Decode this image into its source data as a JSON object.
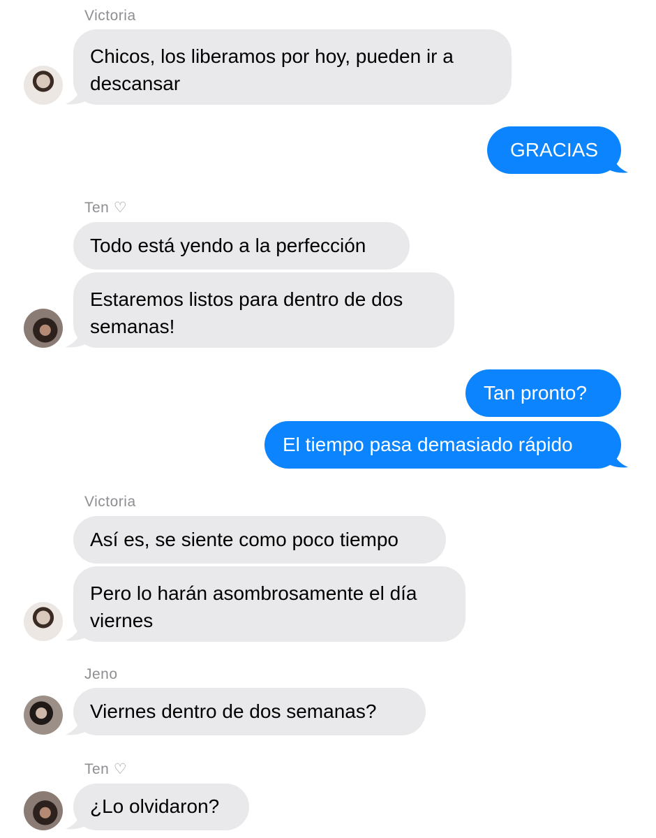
{
  "colors": {
    "incoming_bubble": "#e9e9eb",
    "outgoing_bubble": "#0b84fe",
    "sender_name": "#8e8e93"
  },
  "messages": [
    {
      "sender": "Victoria",
      "text": "Chicos, los liberamos por hoy, pueden ir a descansar"
    },
    {
      "sender": "me",
      "text": "GRACIAS"
    },
    {
      "sender": "Ten ♡",
      "text": "Todo está yendo a la perfección"
    },
    {
      "sender": "Ten ♡",
      "text": "Estaremos listos para dentro de dos semanas!"
    },
    {
      "sender": "me",
      "text": "Tan pronto?"
    },
    {
      "sender": "me",
      "text": "El tiempo pasa demasiado rápido"
    },
    {
      "sender": "Victoria",
      "text": "Así es, se siente como poco tiempo"
    },
    {
      "sender": "Victoria",
      "text": "Pero lo harán asombrosamente el día viernes"
    },
    {
      "sender": "Jeno",
      "text": "Viernes dentro de dos semanas?"
    },
    {
      "sender": "Ten ♡",
      "text": "¿Lo olvidaron?"
    }
  ],
  "sender_labels": [
    "Victoria",
    "Ten ♡",
    "Victoria",
    "Jeno",
    "Ten ♡"
  ],
  "avatars": [
    "victoria-avatar",
    "ten-avatar",
    "victoria-avatar",
    "jeno-avatar",
    "ten-avatar"
  ]
}
